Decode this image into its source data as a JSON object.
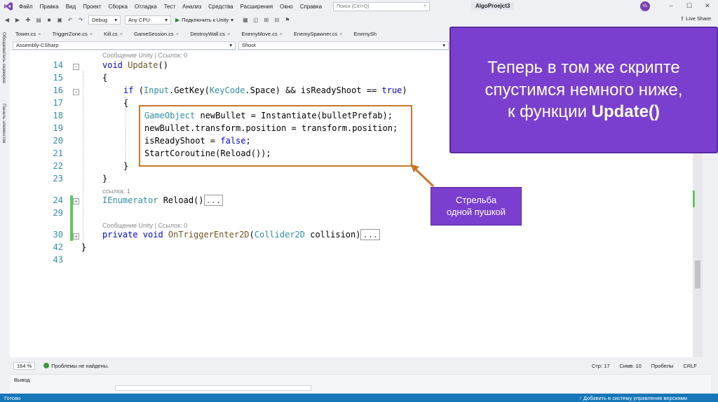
{
  "menu": {
    "items": [
      "Файл",
      "Правка",
      "Вид",
      "Проект",
      "Сборка",
      "Отладка",
      "Тест",
      "Анализ",
      "Средства",
      "Расширения",
      "Окно",
      "Справка"
    ],
    "search_placeholder": "Поиск (Ctrl+Q)",
    "project_title": "AlgoProejct3",
    "user_initials": "VL"
  },
  "toolbar": {
    "config": "Debug",
    "platform": "Any CPU",
    "run_label": "Подключить к Unity",
    "live_share": "Live Share"
  },
  "side_panels": [
    "Обозреватель серверов",
    "Панель элементов"
  ],
  "tabs": [
    "Tower.cs",
    "TriggerZone.cs",
    "Kill.cs",
    "GameSession.cs",
    "DestroyWall.cs",
    "EnemyMove.cs",
    "EnemySpawner.cs",
    "EnemySh"
  ],
  "navbar": {
    "project": "Assembly-CSharp",
    "member": "Shoot"
  },
  "editor": {
    "lens_top": "Сообщение Unity | Ссылок: 0",
    "lens_reload": "ссылка: 1",
    "lens_trigger": "Сообщение Unity | Ссылок: 0",
    "lines": [
      {
        "n": "14",
        "tokens": [
          [
            "kw",
            "void "
          ],
          [
            "me",
            "Update"
          ],
          [
            "",
            "()"
          ]
        ]
      },
      {
        "n": "15",
        "tokens": [
          [
            "",
            "{"
          ]
        ]
      },
      {
        "n": "16",
        "tokens": [
          [
            "kw",
            "if "
          ],
          [
            "",
            "("
          ],
          [
            "ty",
            "Input"
          ],
          [
            "",
            ".GetKey("
          ],
          [
            "ty",
            "KeyCode"
          ],
          [
            "",
            ".Space) && isReadyShoot == "
          ],
          [
            "kw",
            "true"
          ],
          [
            "",
            ")"
          ]
        ]
      },
      {
        "n": "17",
        "tokens": [
          [
            "",
            "{"
          ]
        ]
      },
      {
        "n": "18",
        "tokens": [
          [
            "ty",
            "GameObject"
          ],
          [
            "",
            " newBullet = Instantiate(bulletPrefab);"
          ]
        ]
      },
      {
        "n": "19",
        "tokens": [
          [
            "",
            "newBullet.transform.position = transform.position;"
          ]
        ]
      },
      {
        "n": "20",
        "tokens": [
          [
            "",
            "isReadyShoot = "
          ],
          [
            "kw",
            "false"
          ],
          [
            "",
            ";"
          ]
        ]
      },
      {
        "n": "21",
        "tokens": [
          [
            "",
            "StartCoroutine(Reload());"
          ]
        ]
      },
      {
        "n": "22",
        "tokens": [
          [
            "",
            "}"
          ]
        ]
      },
      {
        "n": "23",
        "tokens": [
          [
            "",
            "}"
          ]
        ]
      },
      {
        "n": "24",
        "tokens": [
          [
            "ty",
            "IEnumerator"
          ],
          [
            "",
            " Reload()"
          ]
        ]
      },
      {
        "n": "29",
        "tokens": []
      },
      {
        "n": "30",
        "tokens": [
          [
            "kw",
            "private void "
          ],
          [
            "me",
            "OnTriggerEnter2D"
          ],
          [
            "",
            "("
          ],
          [
            "ty",
            "Collider2D"
          ],
          [
            "",
            " collision)"
          ]
        ]
      },
      {
        "n": "42",
        "tokens": [
          [
            "",
            "}"
          ]
        ]
      },
      {
        "n": "43",
        "tokens": []
      }
    ],
    "collapsed_marker": "..."
  },
  "status": {
    "zoom": "164 %",
    "issues": "Проблемы не найдены.",
    "line": "Стр: 17",
    "col": "Симв: 10",
    "spaces": "Пробелы",
    "eol": "CRLF"
  },
  "output": {
    "title": "Вывод"
  },
  "statusbar": {
    "ready": "Готово",
    "vcs": "Добавить в систему управления версиями"
  },
  "overlay": {
    "callout_line1": "Теперь в том же скрипте",
    "callout_line2": "спустимся немного ниже,",
    "callout_line3_prefix": "к функции ",
    "callout_line3_bold": "Update()",
    "label_line1": "Стрельба",
    "label_line2": "одной пушкой",
    "accent_purple": "#7b3fcf",
    "highlight_orange": "#c9762b"
  }
}
